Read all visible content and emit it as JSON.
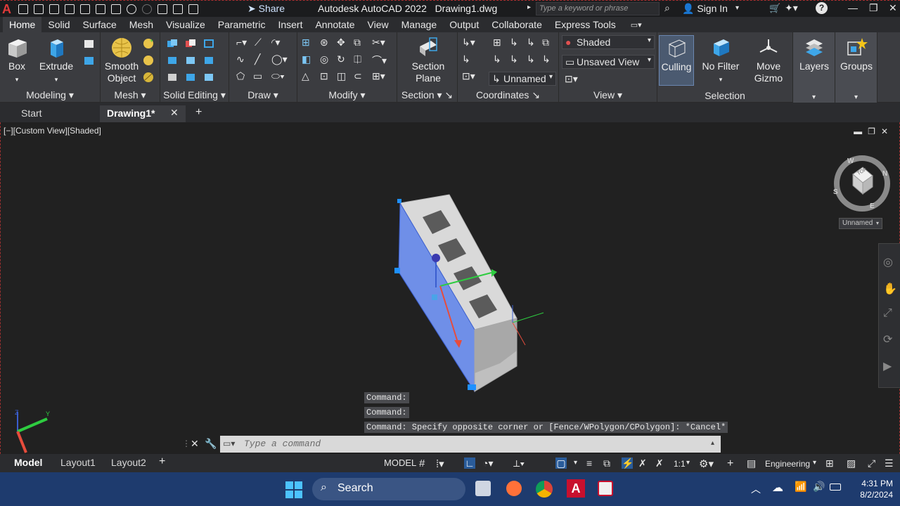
{
  "titlebar": {
    "share_label": "Share",
    "app_title": "Autodesk AutoCAD 2022",
    "file_name": "Drawing1.dwg",
    "search_placeholder": "Type a keyword or phrase",
    "signin_label": "Sign In"
  },
  "ribbon_tabs": [
    "Home",
    "Solid",
    "Surface",
    "Mesh",
    "Visualize",
    "Parametric",
    "Insert",
    "Annotate",
    "View",
    "Manage",
    "Output",
    "Collaborate",
    "Express Tools"
  ],
  "ribbon": {
    "modeling": {
      "title": "Modeling",
      "box": "Box",
      "extrude": "Extrude"
    },
    "mesh": {
      "title": "Mesh",
      "smooth1": "Smooth",
      "smooth2": "Object"
    },
    "solid_editing": {
      "title": "Solid Editing"
    },
    "draw": {
      "title": "Draw"
    },
    "modify": {
      "title": "Modify"
    },
    "section": {
      "title": "Section",
      "plane1": "Section",
      "plane2": "Plane"
    },
    "coordinates": {
      "title": "Coordinates",
      "ucs_combo": "Unnamed"
    },
    "view": {
      "title": "View",
      "visual_style": "Shaded",
      "named_view": "Unsaved View"
    },
    "selection": {
      "title": "Selection",
      "culling": "Culling",
      "no_filter": "No Filter",
      "move_gizmo1": "Move",
      "move_gizmo2": "Gizmo"
    },
    "layers": {
      "label": "Layers"
    },
    "groups": {
      "label": "Groups"
    }
  },
  "file_tabs": {
    "start": "Start",
    "drawing": "Drawing1*"
  },
  "viewport": {
    "label": "[−][Custom View][Shaded]",
    "viewcube_top": "TOP",
    "compass": {
      "n": "N",
      "s": "S",
      "e": "E",
      "w": "W"
    },
    "ucs_name": "Unnamed"
  },
  "command": {
    "history": [
      "Command:",
      "Command:",
      "Command: Specify opposite corner or [Fence/WPolygon/CPolygon]: *Cancel*"
    ],
    "placeholder": "Type a command"
  },
  "layout_tabs": [
    "Model",
    "Layout1",
    "Layout2"
  ],
  "statusbar": {
    "model": "MODEL",
    "scale": "1:1",
    "workspace": "Engineering"
  },
  "taskbar": {
    "search": "Search",
    "time": "4:31 PM",
    "date": "8/2/2024"
  },
  "colors": {
    "accent": "#1e90ff",
    "titlebar": "#1b1c1e",
    "ribbon": "#3b3c40",
    "viewport": "#212121",
    "taskbar": "#1e3b6e"
  }
}
